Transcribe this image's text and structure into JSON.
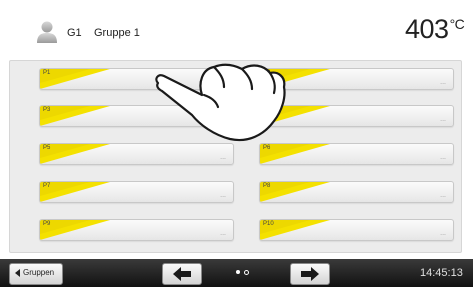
{
  "header": {
    "group_id": "G1",
    "group_name": "Gruppe 1",
    "temperature": "403",
    "temperature_unit": "°C"
  },
  "programs": [
    {
      "label": "P1",
      "dots": ""
    },
    {
      "label": "P2",
      "dots": "..."
    },
    {
      "label": "P3",
      "dots": ""
    },
    {
      "label": "P4",
      "dots": "..."
    },
    {
      "label": "P5",
      "dots": "..."
    },
    {
      "label": "P6",
      "dots": "..."
    },
    {
      "label": "P7",
      "dots": "..."
    },
    {
      "label": "P8",
      "dots": "..."
    },
    {
      "label": "P9",
      "dots": "..."
    },
    {
      "label": "P10",
      "dots": "..."
    }
  ],
  "footer": {
    "back_label": "Gruppen",
    "prev_icon": "arrow-left-icon",
    "next_icon": "arrow-right-icon",
    "page_count": 2,
    "current_page": 1,
    "time": "14:45:13"
  },
  "colors": {
    "accent": "#f5e000",
    "footer_bg": "#1e1e1e"
  }
}
